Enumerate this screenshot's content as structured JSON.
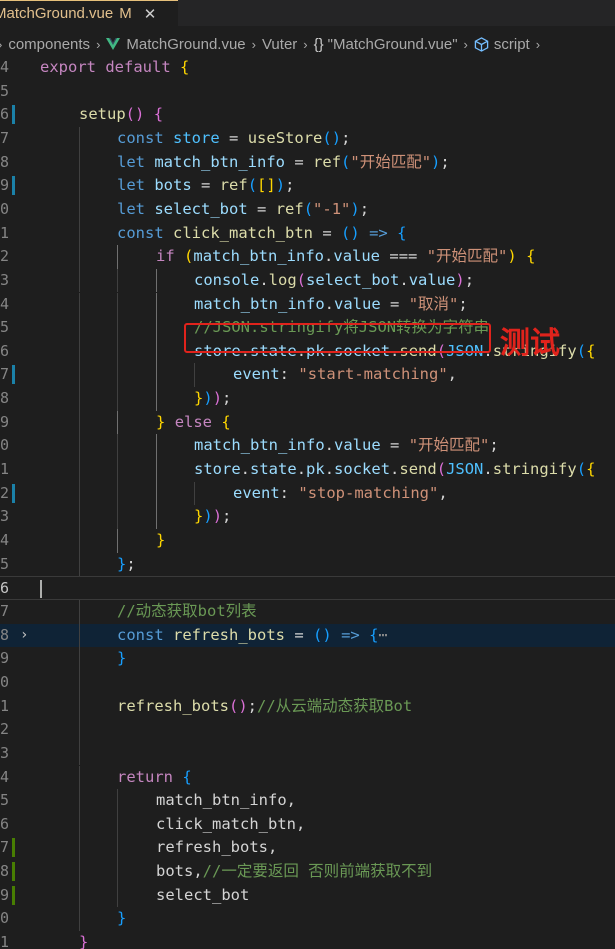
{
  "tab": {
    "filename": "MatchGround.vue",
    "modified": "M",
    "close_glyph": "✕"
  },
  "breadcrumb": {
    "items": [
      "components",
      "MatchGround.vue",
      "Vuter",
      "\"MatchGround.vue\"",
      "script"
    ],
    "separator": "›",
    "braces": "{}"
  },
  "annotation": {
    "label": "测试",
    "color": "#e0231c"
  },
  "editor": {
    "line_numbers": [
      "4",
      "5",
      "6",
      "7",
      "8",
      "9",
      "0",
      "1",
      "2",
      "3",
      "4",
      "5",
      "6",
      "7",
      "8",
      "9",
      "0",
      "1",
      "2",
      "3",
      "4",
      "5",
      "6",
      "7",
      "8",
      "9",
      "0",
      "1",
      "2",
      "3",
      "4",
      "5",
      "6",
      "7",
      "8",
      "9",
      "0",
      "1"
    ],
    "ellipsis": "⋯",
    "code": {
      "l1": [
        "export",
        "default",
        "{"
      ],
      "l3": [
        "setup",
        "(",
        ")",
        "{"
      ],
      "l4": [
        "const",
        "store",
        "=",
        "useStore",
        "(",
        ")",
        ";"
      ],
      "l5": [
        "let",
        "match_btn_info",
        "=",
        "ref",
        "(",
        "\"开始匹配\"",
        ")",
        ";"
      ],
      "l6": [
        "let",
        "bots",
        "=",
        "ref",
        "(",
        "[",
        "]",
        ")",
        ";"
      ],
      "l7": [
        "let",
        "select_bot",
        "=",
        "ref",
        "(",
        "\"-1\"",
        ")",
        ";"
      ],
      "l8": [
        "const",
        "click_match_btn",
        "=",
        "(",
        ")",
        "=>",
        "{"
      ],
      "l9": [
        "if",
        "(",
        "match_btn_info",
        ".",
        "value",
        "===",
        "\"开始匹配\"",
        ")",
        "{"
      ],
      "l10": [
        "console",
        ".",
        "log",
        "(",
        "select_bot",
        ".",
        "value",
        ")",
        ";"
      ],
      "l11": [
        "match_btn_info",
        ".",
        "value",
        "=",
        "\"取消\"",
        ";"
      ],
      "l12": [
        "//JSON.stringify将JSON转换为字符串"
      ],
      "l13": [
        "store",
        ".",
        "state",
        ".",
        "pk",
        ".",
        "socket",
        ".",
        "send",
        "(",
        "JSON",
        ".",
        "stringify",
        "(",
        "{"
      ],
      "l14": [
        "event",
        ":",
        "\"start-matching\"",
        ","
      ],
      "l15": [
        "}",
        ")",
        ")",
        ";"
      ],
      "l16": [
        "}",
        "else",
        "{"
      ],
      "l17": [
        "match_btn_info",
        ".",
        "value",
        "=",
        "\"开始匹配\"",
        ";"
      ],
      "l18": [
        "store",
        ".",
        "state",
        ".",
        "pk",
        ".",
        "socket",
        ".",
        "send",
        "(",
        "JSON",
        ".",
        "stringify",
        "(",
        "{"
      ],
      "l19": [
        "event",
        ":",
        "\"stop-matching\"",
        ","
      ],
      "l20": [
        "}",
        ")",
        ")",
        ";"
      ],
      "l21": [
        "}"
      ],
      "l22": [
        "}",
        ";"
      ],
      "l24": [
        "//动态获取bot列表"
      ],
      "l25": [
        "const",
        "refresh_bots",
        "=",
        "(",
        ")",
        "=>",
        "{"
      ],
      "l26": [
        "}"
      ],
      "l28": [
        "refresh_bots",
        "(",
        ")",
        ";",
        "//从云端动态获取Bot"
      ],
      "l31": [
        "return",
        "{"
      ],
      "l32": [
        "match_btn_info",
        ","
      ],
      "l33": [
        "click_match_btn",
        ","
      ],
      "l34": [
        "refresh_bots",
        ","
      ],
      "l35": [
        "bots",
        ",",
        "//一定要返回 否则前端获取不到"
      ],
      "l36": [
        "select_bot"
      ],
      "l37": [
        "}"
      ],
      "l38": [
        "}"
      ]
    }
  }
}
